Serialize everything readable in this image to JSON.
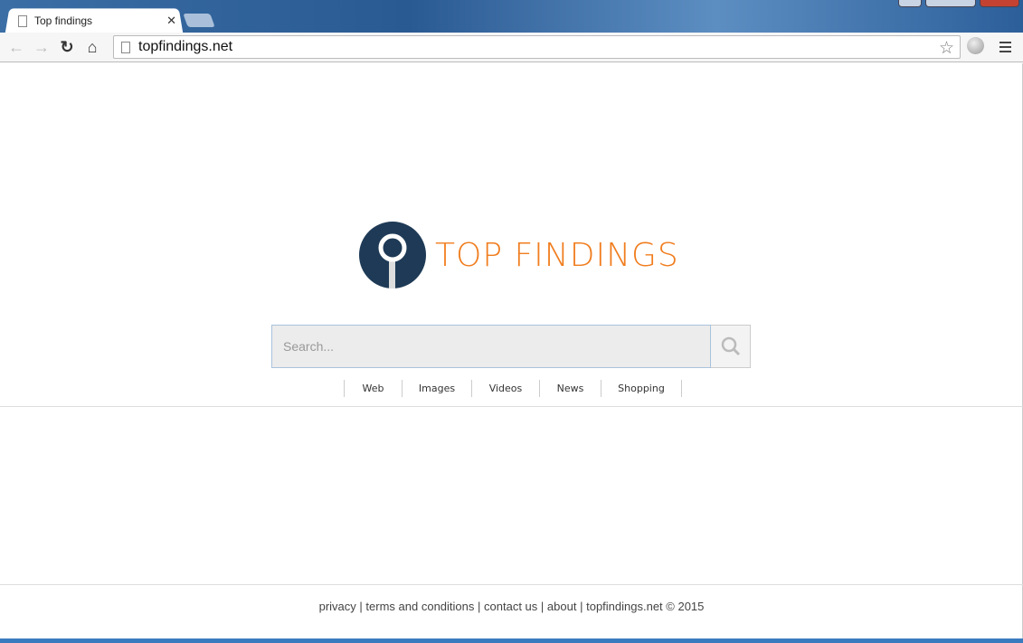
{
  "browser": {
    "tab_title": "Top findings",
    "url": "topfindings.net"
  },
  "logo": {
    "text": "TOP FINDINGS",
    "color": "#f07d1e",
    "circle_color": "#1e3a56"
  },
  "search": {
    "placeholder": "Search..."
  },
  "categories": [
    "Web",
    "Images",
    "Videos",
    "News",
    "Shopping"
  ],
  "footer": {
    "links": [
      "privacy",
      "terms and conditions",
      "contact us",
      "about"
    ],
    "copyright": "topfindings.net © 2015",
    "separator": "|"
  }
}
